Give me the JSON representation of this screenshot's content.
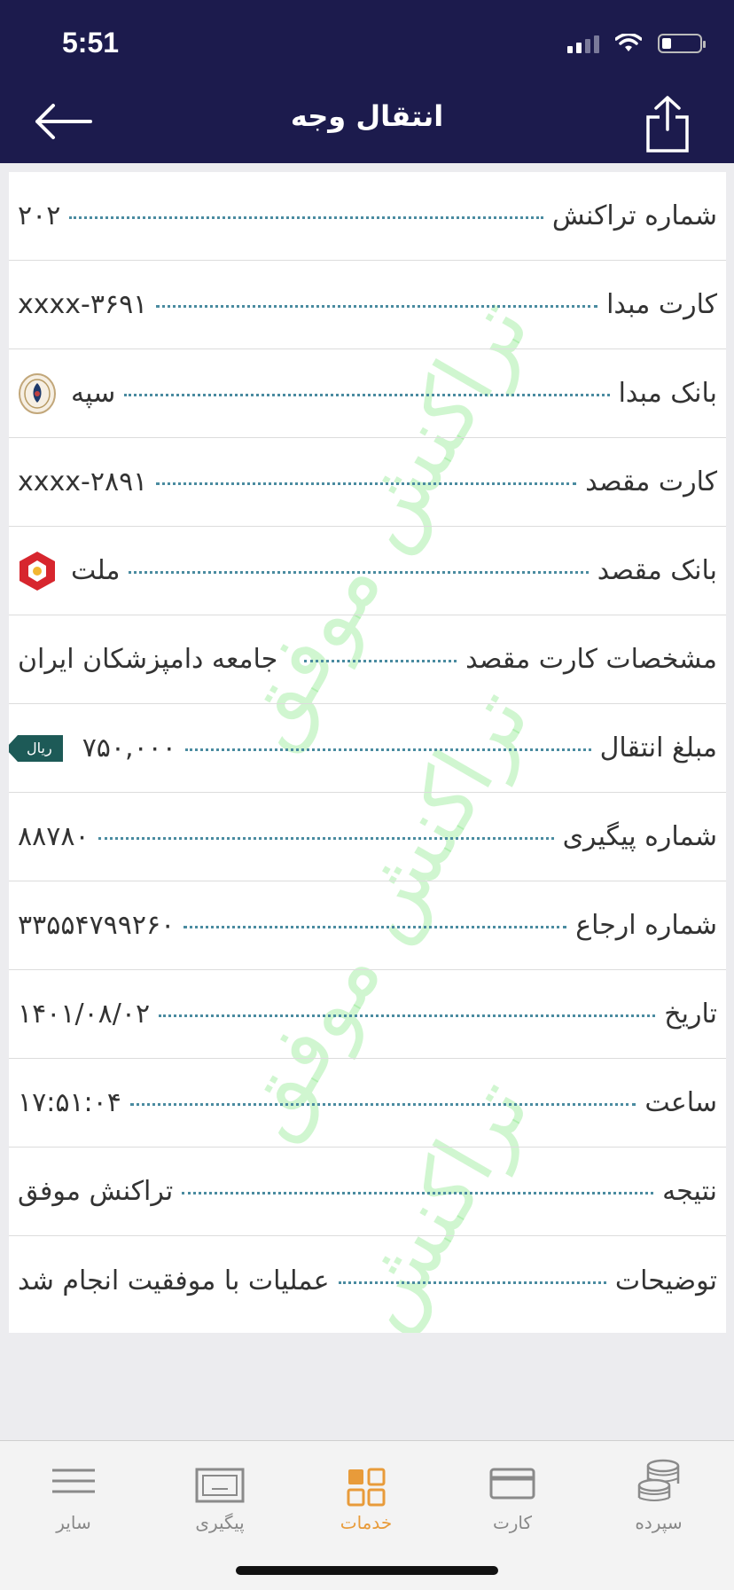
{
  "status_bar": {
    "time": "5:51"
  },
  "header": {
    "title": "انتقال وجه"
  },
  "watermark_text": "تراکنش موفق",
  "details": [
    {
      "label": "شماره تراکنش",
      "value": "۲۰۲"
    },
    {
      "label": "کارت مبدا",
      "value": "xxxx-۳۶۹۱"
    },
    {
      "label": "بانک مبدا",
      "value": "سپه",
      "icon": "sepah-bank-logo-icon"
    },
    {
      "label": "کارت مقصد",
      "value": "xxxx-۲۸۹۱"
    },
    {
      "label": "بانک مقصد",
      "value": "ملت",
      "icon": "mellat-bank-logo-icon"
    },
    {
      "label": "مشخصات کارت مقصد",
      "value": "جامعه دامپزشکان ایران"
    },
    {
      "label": "مبلغ انتقال",
      "value": "۷۵۰,۰۰۰",
      "unit": "ریال"
    },
    {
      "label": "شماره پیگیری",
      "value": "۸۸۷۸۰"
    },
    {
      "label": "شماره ارجاع",
      "value": "۳۳۵۵۴۷۹۹۲۶۰"
    },
    {
      "label": "تاریخ",
      "value": "۱۴۰۱/۰۸/۰۲"
    },
    {
      "label": "ساعت",
      "value": "۱۷:۵۱:۰۴"
    },
    {
      "label": "نتیجه",
      "value": "تراکنش موفق"
    },
    {
      "label": "توضیحات",
      "value": "عملیات با موفقیت انجام شد"
    }
  ],
  "tabbar": {
    "items": [
      {
        "label": "سایر",
        "icon": "menu-icon",
        "active": false
      },
      {
        "label": "پیگیری",
        "icon": "tracking-icon",
        "active": false
      },
      {
        "label": "خدمات",
        "icon": "services-grid-icon",
        "active": true
      },
      {
        "label": "کارت",
        "icon": "card-icon",
        "active": false
      },
      {
        "label": "سپرده",
        "icon": "coins-icon",
        "active": false
      }
    ]
  },
  "colors": {
    "header_bg": "#1c1b4d",
    "active_tab": "#e89b3a",
    "dotted_leader": "#4a8ba0",
    "currency_badge": "#1d5a57"
  }
}
